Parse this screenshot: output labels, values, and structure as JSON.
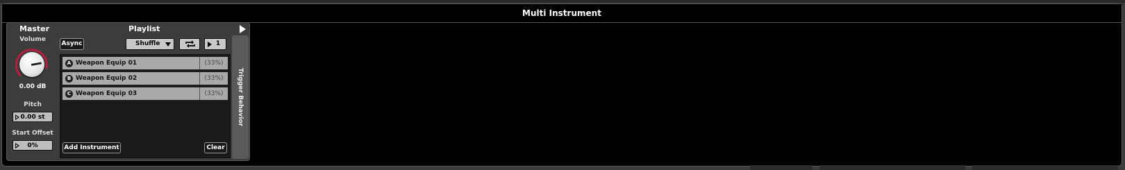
{
  "window": {
    "title": "Multi Instrument"
  },
  "master": {
    "header": "Master",
    "volume_label": "Volume",
    "volume_value": "0.00 dB",
    "pitch_label": "Pitch",
    "pitch_value": "0.00 st",
    "start_offset_label": "Start Offset",
    "start_offset_value": "0%"
  },
  "playlist": {
    "header": "Playlist",
    "async_label": "Async",
    "mode_value": "Shuffle",
    "repeat_icon": "repeat-icon",
    "count_value": "1",
    "items": [
      {
        "letter": "A",
        "name": "Weapon Equip 01",
        "percent": "(33%)"
      },
      {
        "letter": "B",
        "name": "Weapon Equip 02",
        "percent": "(33%)"
      },
      {
        "letter": "C",
        "name": "Weapon Equip 03",
        "percent": "(33%)"
      }
    ],
    "add_label": "Add Instrument",
    "clear_label": "Clear"
  },
  "side_tab": {
    "label": "Trigger Behavior"
  },
  "colors": {
    "knob_ring": "#b81f3e",
    "background": "#000000",
    "panel": "#3c3c3c"
  }
}
